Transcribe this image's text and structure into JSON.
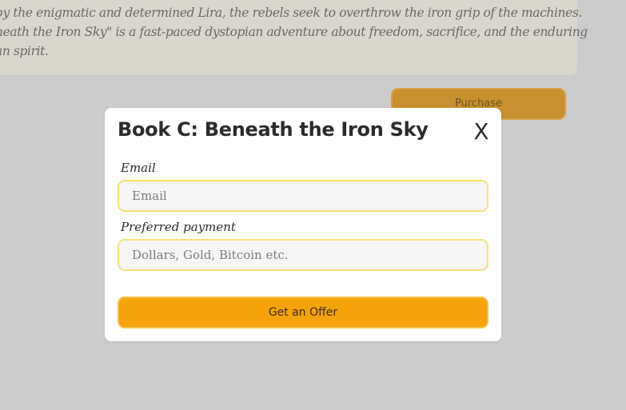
{
  "background": {
    "description_lines": [
      "by the enigmatic and determined Lira, the rebels seek to overthrow the iron grip of the machines.",
      "neath the Iron Sky\" is a fast-paced dystopian adventure about freedom, sacrifice, and the enduring",
      "an spirit."
    ],
    "purchase_label": "Purchase"
  },
  "modal": {
    "title": "Book C: Beneath the Iron Sky",
    "close_label": "X",
    "email": {
      "label": "Email",
      "placeholder": "Email",
      "value": ""
    },
    "payment": {
      "label": "Preferred payment",
      "placeholder": "Dollars, Gold, Bitcoin etc.",
      "value": ""
    },
    "submit_label": "Get an Offer"
  },
  "colors": {
    "overlay_background": "#cbcbcb",
    "accent": "#f5a20d",
    "field_border": "#f7e07a"
  }
}
